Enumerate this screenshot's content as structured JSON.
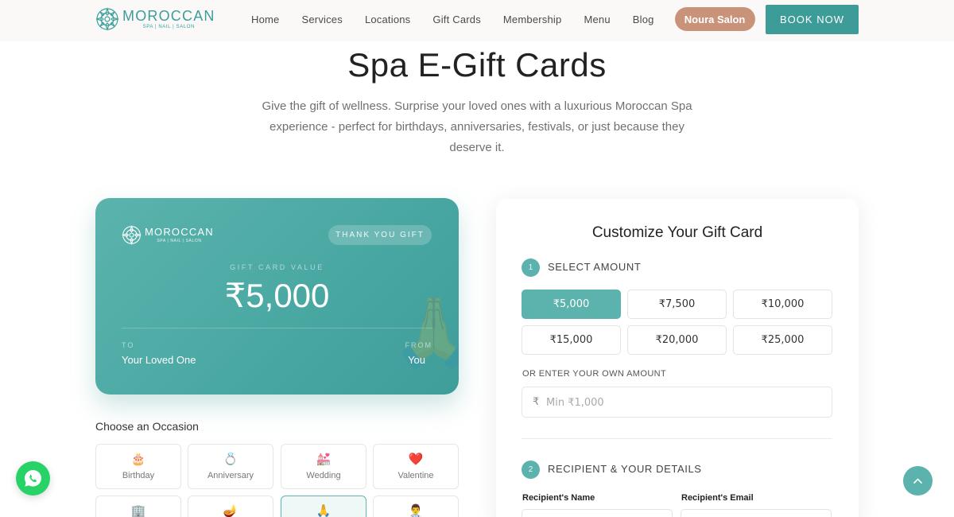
{
  "brand": {
    "name": "MOROCCAN",
    "tagline": "SPA | NAIL | SALON"
  },
  "nav": {
    "items": [
      "Home",
      "Services",
      "Locations",
      "Gift Cards",
      "Membership",
      "Menu",
      "Blog"
    ],
    "pill": "Noura Salon",
    "book": "BOOK NOW"
  },
  "hero": {
    "title": "Spa E-Gift Cards",
    "description": "Give the gift of wellness. Surprise your loved ones with a luxurious Moroccan Spa experience - perfect for birthdays, anniversaries, festivals, or just because they deserve it."
  },
  "card": {
    "badge": "THANK YOU GIFT",
    "value_label": "GIFT CARD VALUE",
    "value": "₹5,000",
    "to_label": "TO",
    "to_value": "Your Loved One",
    "from_label": "FROM",
    "from_value": "You",
    "watermark_icon": "🙏"
  },
  "occasions": {
    "title": "Choose an Occasion",
    "items": [
      {
        "label": "Birthday",
        "icon": "🎂",
        "icon_name": "birthday-cake-icon"
      },
      {
        "label": "Anniversary",
        "icon": "💍",
        "icon_name": "ring-icon"
      },
      {
        "label": "Wedding",
        "icon": "💒",
        "icon_name": "wedding-chapel-icon"
      },
      {
        "label": "Valentine",
        "icon": "❤️",
        "icon_name": "heart-icon"
      },
      {
        "label": "",
        "icon": "🏢",
        "icon_name": "office-building-icon"
      },
      {
        "label": "",
        "icon": "🪔",
        "icon_name": "diya-lamp-icon"
      },
      {
        "label": "",
        "icon": "🙏",
        "icon_name": "folded-hands-icon"
      },
      {
        "label": "",
        "icon": "👨‍⚕️",
        "icon_name": "health-worker-icon"
      }
    ],
    "selected_index": 6
  },
  "form": {
    "title": "Customize Your Gift Card",
    "step1": {
      "num": "1",
      "label": "SELECT AMOUNT"
    },
    "amounts": [
      "₹5,000",
      "₹7,500",
      "₹10,000",
      "₹15,000",
      "₹20,000",
      "₹25,000"
    ],
    "selected_amount_index": 0,
    "own_label": "OR ENTER YOUR OWN AMOUNT",
    "own_currency": "₹",
    "own_placeholder": "Min ₹1,000",
    "step2": {
      "num": "2",
      "label": "RECIPIENT & YOUR DETAILS"
    },
    "recipient_name_label": "Recipient's Name",
    "recipient_email_label": "Recipient's Email"
  },
  "colors": {
    "accent": "#3d9c98",
    "card": "#4aa8a3",
    "pill": "#c99379",
    "whatsapp": "#27d366"
  }
}
